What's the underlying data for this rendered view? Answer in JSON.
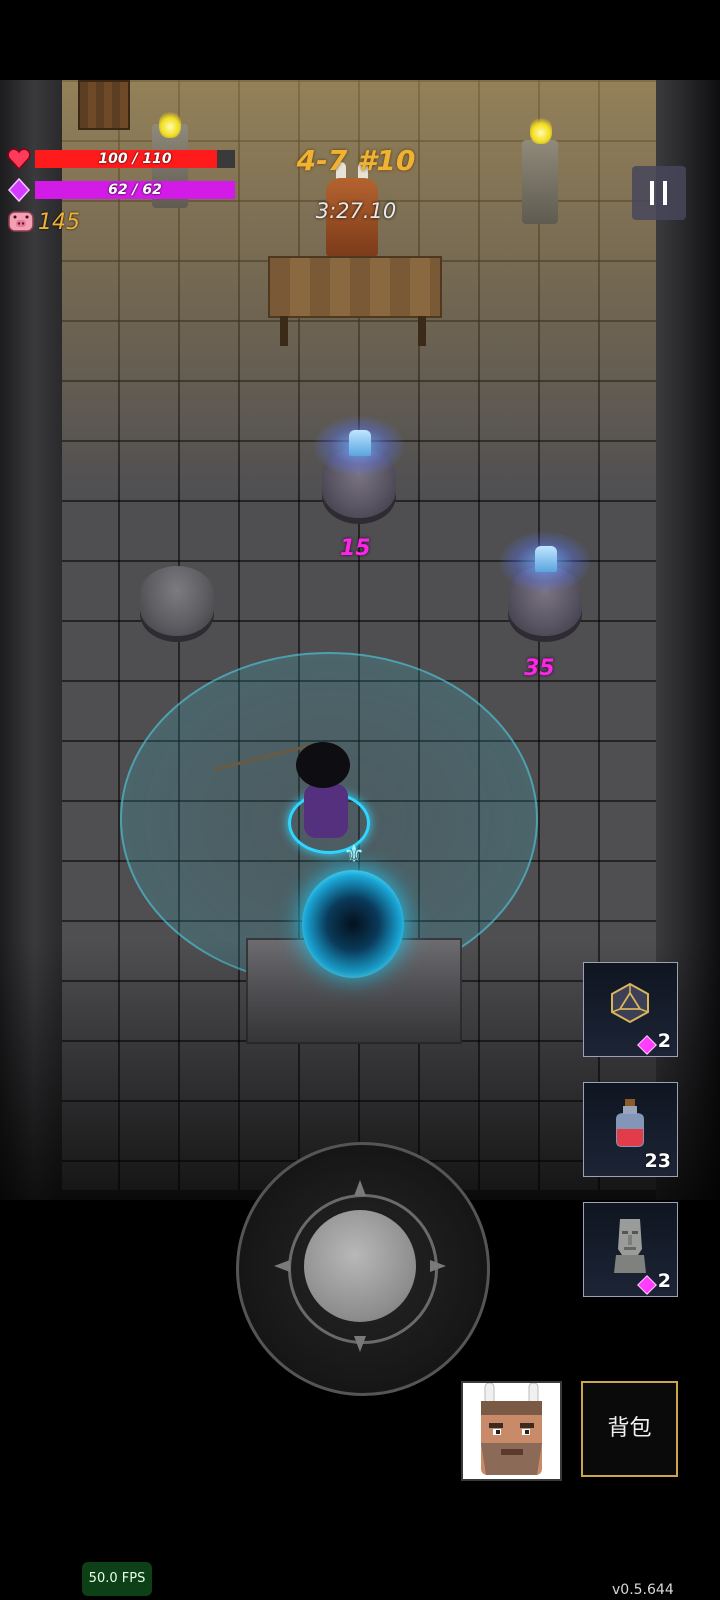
{
  "hud": {
    "health": {
      "text": "100 / 110",
      "current": 100,
      "max": 110,
      "color": "#ff1b1b",
      "icon": "heart-icon"
    },
    "mana": {
      "text": "62 / 62",
      "current": 62,
      "max": 62,
      "color": "#d21be6",
      "icon": "diamond-icon"
    },
    "gold": {
      "value": "145",
      "icon": "pig-icon"
    },
    "stage": "4-7 #10",
    "timer": "3:27.10",
    "pause_icon": "pause-icon"
  },
  "scene": {
    "prices": [
      "15",
      "35"
    ]
  },
  "inventory": {
    "slots": [
      {
        "item": "d20-dice-icon",
        "count": "2",
        "currency": "gem"
      },
      {
        "item": "red-potion-icon",
        "count": "23",
        "currency": ""
      },
      {
        "item": "moai-statue-icon",
        "count": "2",
        "currency": "gem"
      }
    ]
  },
  "controls": {
    "joystick": "virtual-joystick",
    "character_portrait": "bunny-eared-bearded-merchant-avatar",
    "bag_label": "背包"
  },
  "footer": {
    "fps": "50.0 FPS",
    "version": "v0.5.644"
  },
  "colors": {
    "gold_text": "#f0b232",
    "price_text": "#ff25e6",
    "portal": "#1ec9f2",
    "bag_border": "#c9a74a"
  }
}
